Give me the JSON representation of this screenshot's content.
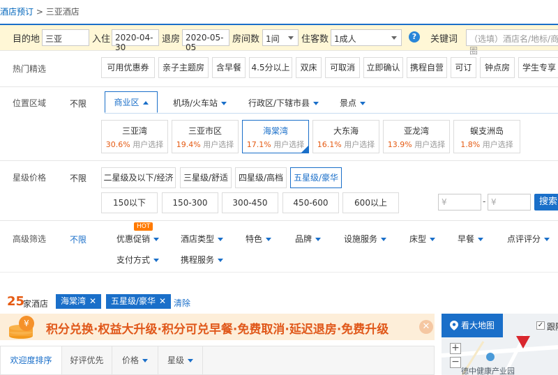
{
  "breadcrumb": {
    "root": "酒店预订",
    "sep": " > ",
    "current": "三亚酒店"
  },
  "searchbar": {
    "destination_label": "目的地",
    "destination_value": "三亚",
    "checkin_label": "入住",
    "checkin_value": "2020-04-30",
    "checkout_label": "退房",
    "checkout_value": "2020-05-05",
    "rooms_label": "房间数",
    "rooms_value": "1间",
    "guests_label": "住客数",
    "guests_value": "1成人",
    "keyword_label": "关键词",
    "keyword_placeholder": "（选填）酒店名/地标/商圈"
  },
  "hot": {
    "title": "热门精选",
    "items": [
      "可用优惠券",
      "亲子主题房",
      "含早餐",
      "4.5分以上",
      "双床",
      "可取消",
      "立即确认",
      "携程自营",
      "可订",
      "钟点房",
      "学生专享"
    ]
  },
  "location": {
    "title": "位置区域",
    "unlimited": "不限",
    "tabs": [
      "商业区",
      "机场/火车站",
      "行政区/下辖市县",
      "景点"
    ],
    "suffix": "用户选择",
    "areas": [
      {
        "name": "三亚湾",
        "pct": "30.6%"
      },
      {
        "name": "三亚市区",
        "pct": "19.4%"
      },
      {
        "name": "海棠湾",
        "pct": "17.1%"
      },
      {
        "name": "大东海",
        "pct": "16.1%"
      },
      {
        "name": "亚龙湾",
        "pct": "13.9%"
      },
      {
        "name": "蜈支洲岛",
        "pct": "1.8%"
      }
    ]
  },
  "star": {
    "title": "星级价格",
    "unlimited": "不限",
    "levels": [
      "二星级及以下/经济",
      "三星级/舒适",
      "四星级/高档",
      "五星级/豪华"
    ],
    "prices": [
      "150以下",
      "150-300",
      "300-450",
      "450-600",
      "600以上"
    ],
    "currency": "¥",
    "dash": "-",
    "search_label": "搜索"
  },
  "advanced": {
    "title": "高级筛选",
    "unlimited": "不限",
    "hot_badge": "HOT",
    "items": [
      "优惠促销",
      "酒店类型",
      "特色",
      "品牌",
      "设施服务",
      "床型",
      "早餐",
      "点评评分",
      "支付方式",
      "携程服务"
    ]
  },
  "results": {
    "count": "25",
    "count_suffix": "家酒店",
    "tags": [
      "海棠湾",
      "五星级/豪华"
    ],
    "tag_close": "✕",
    "clear": "清除"
  },
  "promo": {
    "coin_symbol": "¥",
    "text": "积分兑换·权益大升级·积分可兑早餐·免费取消·延迟退房·免费升级",
    "close": "✕"
  },
  "sort": {
    "tabs": [
      "欢迎度排序",
      "好评优先",
      "价格",
      "星级"
    ]
  },
  "map": {
    "button": "看大地图",
    "follow_check": "✓",
    "follow_label": "跟随",
    "zoom_in": "+",
    "zoom_out": "−",
    "place": "德中健康产业园"
  },
  "colors": {
    "accent": "#1a6fc9",
    "orange": "#e55a12",
    "bar_bg": "#fff7d6",
    "promo_bg": "#fdeed9"
  }
}
